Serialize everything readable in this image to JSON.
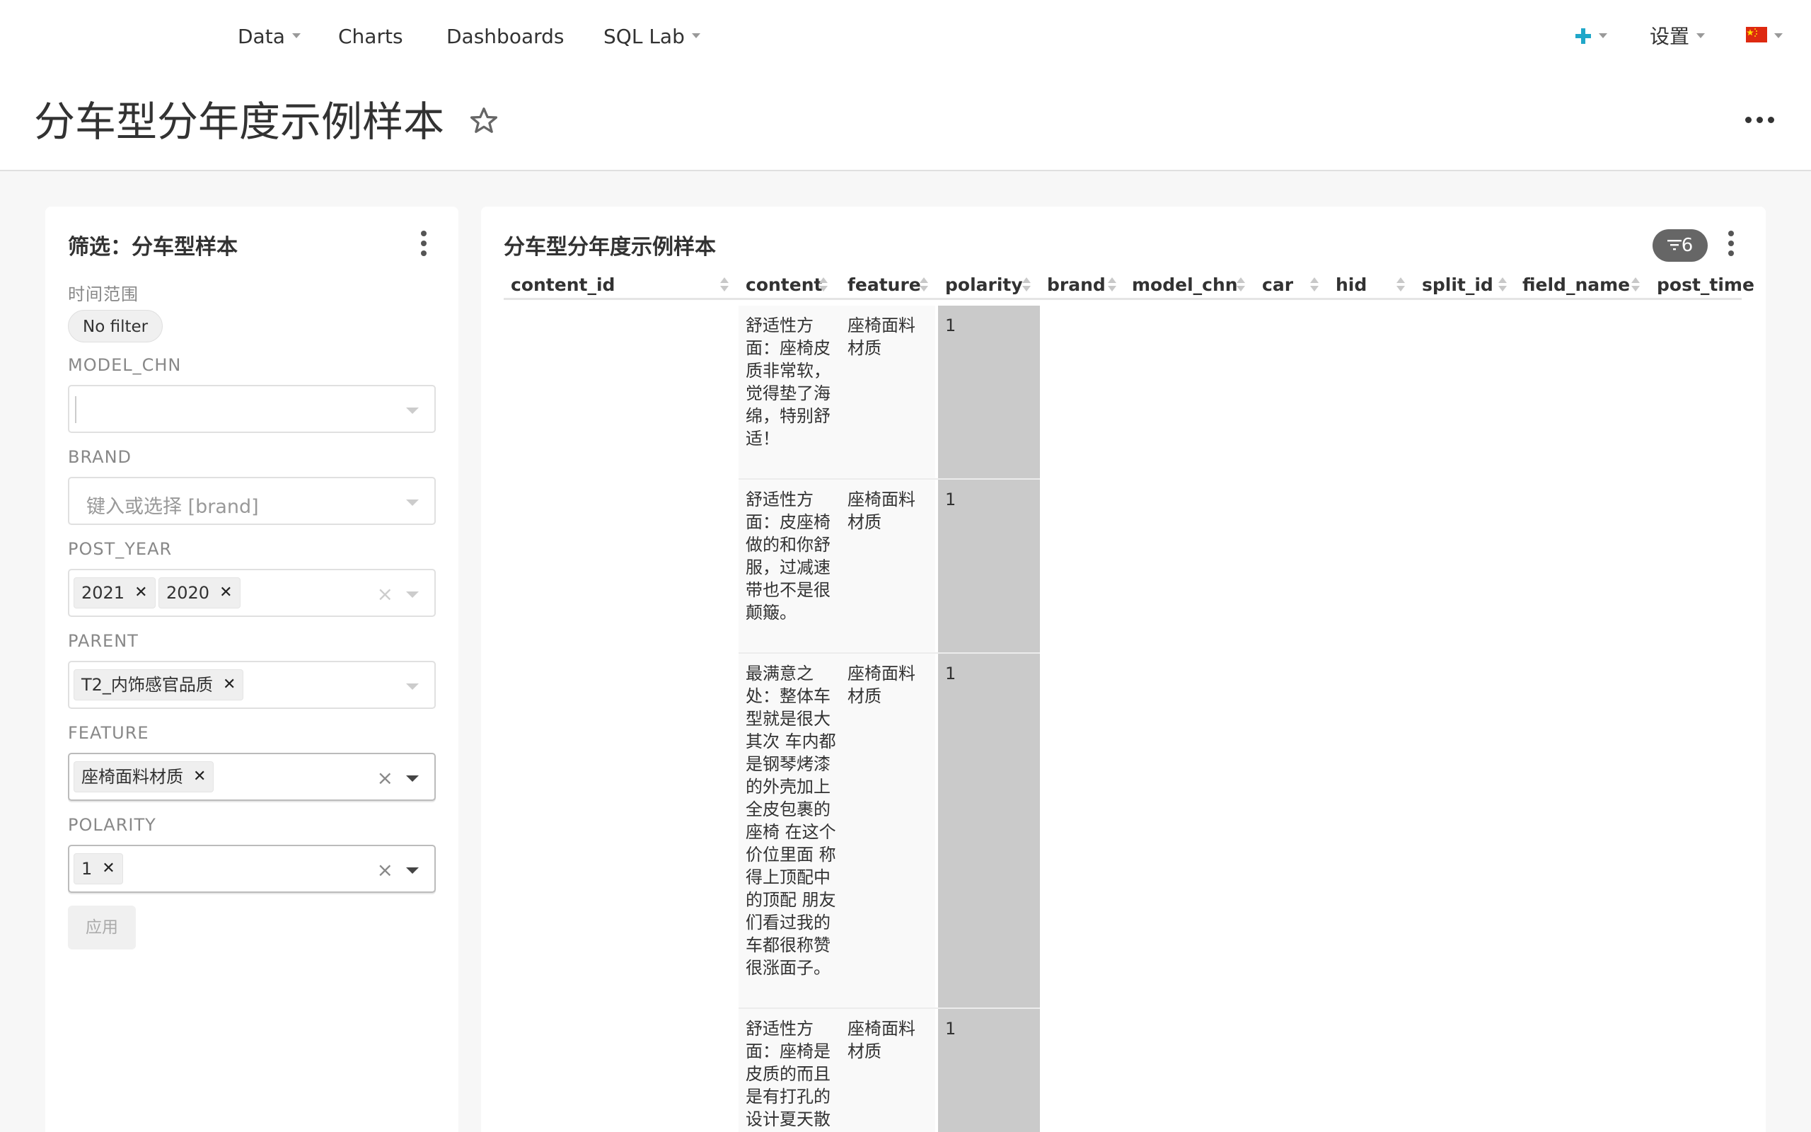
{
  "navbar": {
    "menu": [
      {
        "label": "Data",
        "has_caret": true
      },
      {
        "label": "Charts",
        "has_caret": false
      },
      {
        "label": "Dashboards",
        "has_caret": false
      },
      {
        "label": "SQL Lab",
        "has_caret": true
      }
    ],
    "right": {
      "add_icon": "plus-icon",
      "settings_label": "设置",
      "language_icon": "china-flag-icon"
    }
  },
  "header": {
    "title": "分车型分年度示例样本",
    "favorite_icon": "star-icon",
    "more_icon": "more-horizontal-icon"
  },
  "filters": {
    "title": "筛选：分车型样本",
    "time_range": {
      "label": "时间范围",
      "value": "No filter"
    },
    "model_chn": {
      "label": "MODEL_CHN",
      "placeholder": ""
    },
    "brand": {
      "label": "BRAND",
      "placeholder": "键入或选择 [brand]"
    },
    "post_year": {
      "label": "POST_YEAR",
      "values": [
        "2021",
        "2020"
      ]
    },
    "parent": {
      "label": "PARENT",
      "values": [
        "T2_内饰感官品质"
      ]
    },
    "feature": {
      "label": "FEATURE",
      "values": [
        "座椅面料材质"
      ]
    },
    "polarity": {
      "label": "POLARITY",
      "values": [
        "1"
      ]
    },
    "apply_label": "应用"
  },
  "table": {
    "title": "分车型分年度示例样本",
    "filter_count": "6",
    "columns": [
      "content_id",
      "content",
      "feature",
      "polarity",
      "brand",
      "model_chn",
      "car",
      "hid",
      "split_id",
      "field_name",
      "post_time"
    ],
    "rows": [
      {
        "content": "舒适性方面：座椅皮质非常软，觉得垫了海绵，特别舒适！",
        "feature": "座椅面料材质",
        "polarity": "1"
      },
      {
        "content": "舒适性方面：皮座椅做的和你舒服，过减速带也不是很颠簸。",
        "feature": "座椅面料材质",
        "polarity": "1"
      },
      {
        "content": "最满意之处：整体车型就是很大 其次 车内都是钢琴烤漆的外壳加上全皮包裹的座椅 在这个价位里面 称得上顶配中的顶配 朋友们看过我的车都很称赞很涨面子。",
        "feature": "座椅面料材质",
        "polarity": "1"
      },
      {
        "content": "舒适性方面：座椅是皮质的而且是有打孔的设计夏天散",
        "feature": "座椅面料材质",
        "polarity": "1"
      }
    ]
  },
  "colors": {
    "accent": "#20a7c9",
    "polarity_highlight": "#cacaca",
    "flag_red": "#de2910",
    "flag_yellow": "#ffde00"
  }
}
